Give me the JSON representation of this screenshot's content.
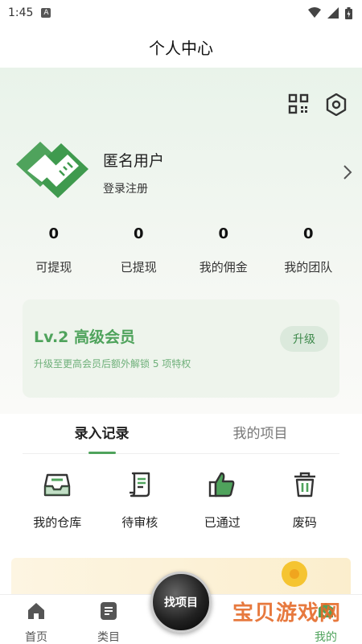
{
  "status": {
    "time": "1:45",
    "notif_glyph": "A"
  },
  "page_title": "个人中心",
  "profile": {
    "name": "匿名用户",
    "login": "登录注册"
  },
  "stats": [
    {
      "value": "0",
      "label": "可提现"
    },
    {
      "value": "0",
      "label": "已提现"
    },
    {
      "value": "0",
      "label": "我的佣金"
    },
    {
      "value": "0",
      "label": "我的团队"
    }
  ],
  "vip": {
    "title": "Lv.2 高级会员",
    "desc": "升级至更高会员后额外解锁 5 项特权",
    "button": "升级"
  },
  "tabs": [
    {
      "label": "录入记录"
    },
    {
      "label": "我的项目"
    }
  ],
  "grid": [
    {
      "label": "我的仓库",
      "icon": "inbox-icon"
    },
    {
      "label": "待审核",
      "icon": "scroll-icon"
    },
    {
      "label": "已通过",
      "icon": "thumbs-up-icon"
    },
    {
      "label": "废码",
      "icon": "trash-icon"
    }
  ],
  "tabbar": [
    {
      "label": "首页",
      "icon": "home-icon"
    },
    {
      "label": "类目",
      "icon": "category-icon"
    },
    {
      "label": "找项目",
      "icon": "find-project-icon"
    },
    {
      "label": "我的",
      "icon": "profile-icon"
    }
  ],
  "watermark": {
    "text": "宝贝游戏网"
  },
  "colors": {
    "accent": "#4fa35c",
    "background": "#e9f3ea"
  }
}
